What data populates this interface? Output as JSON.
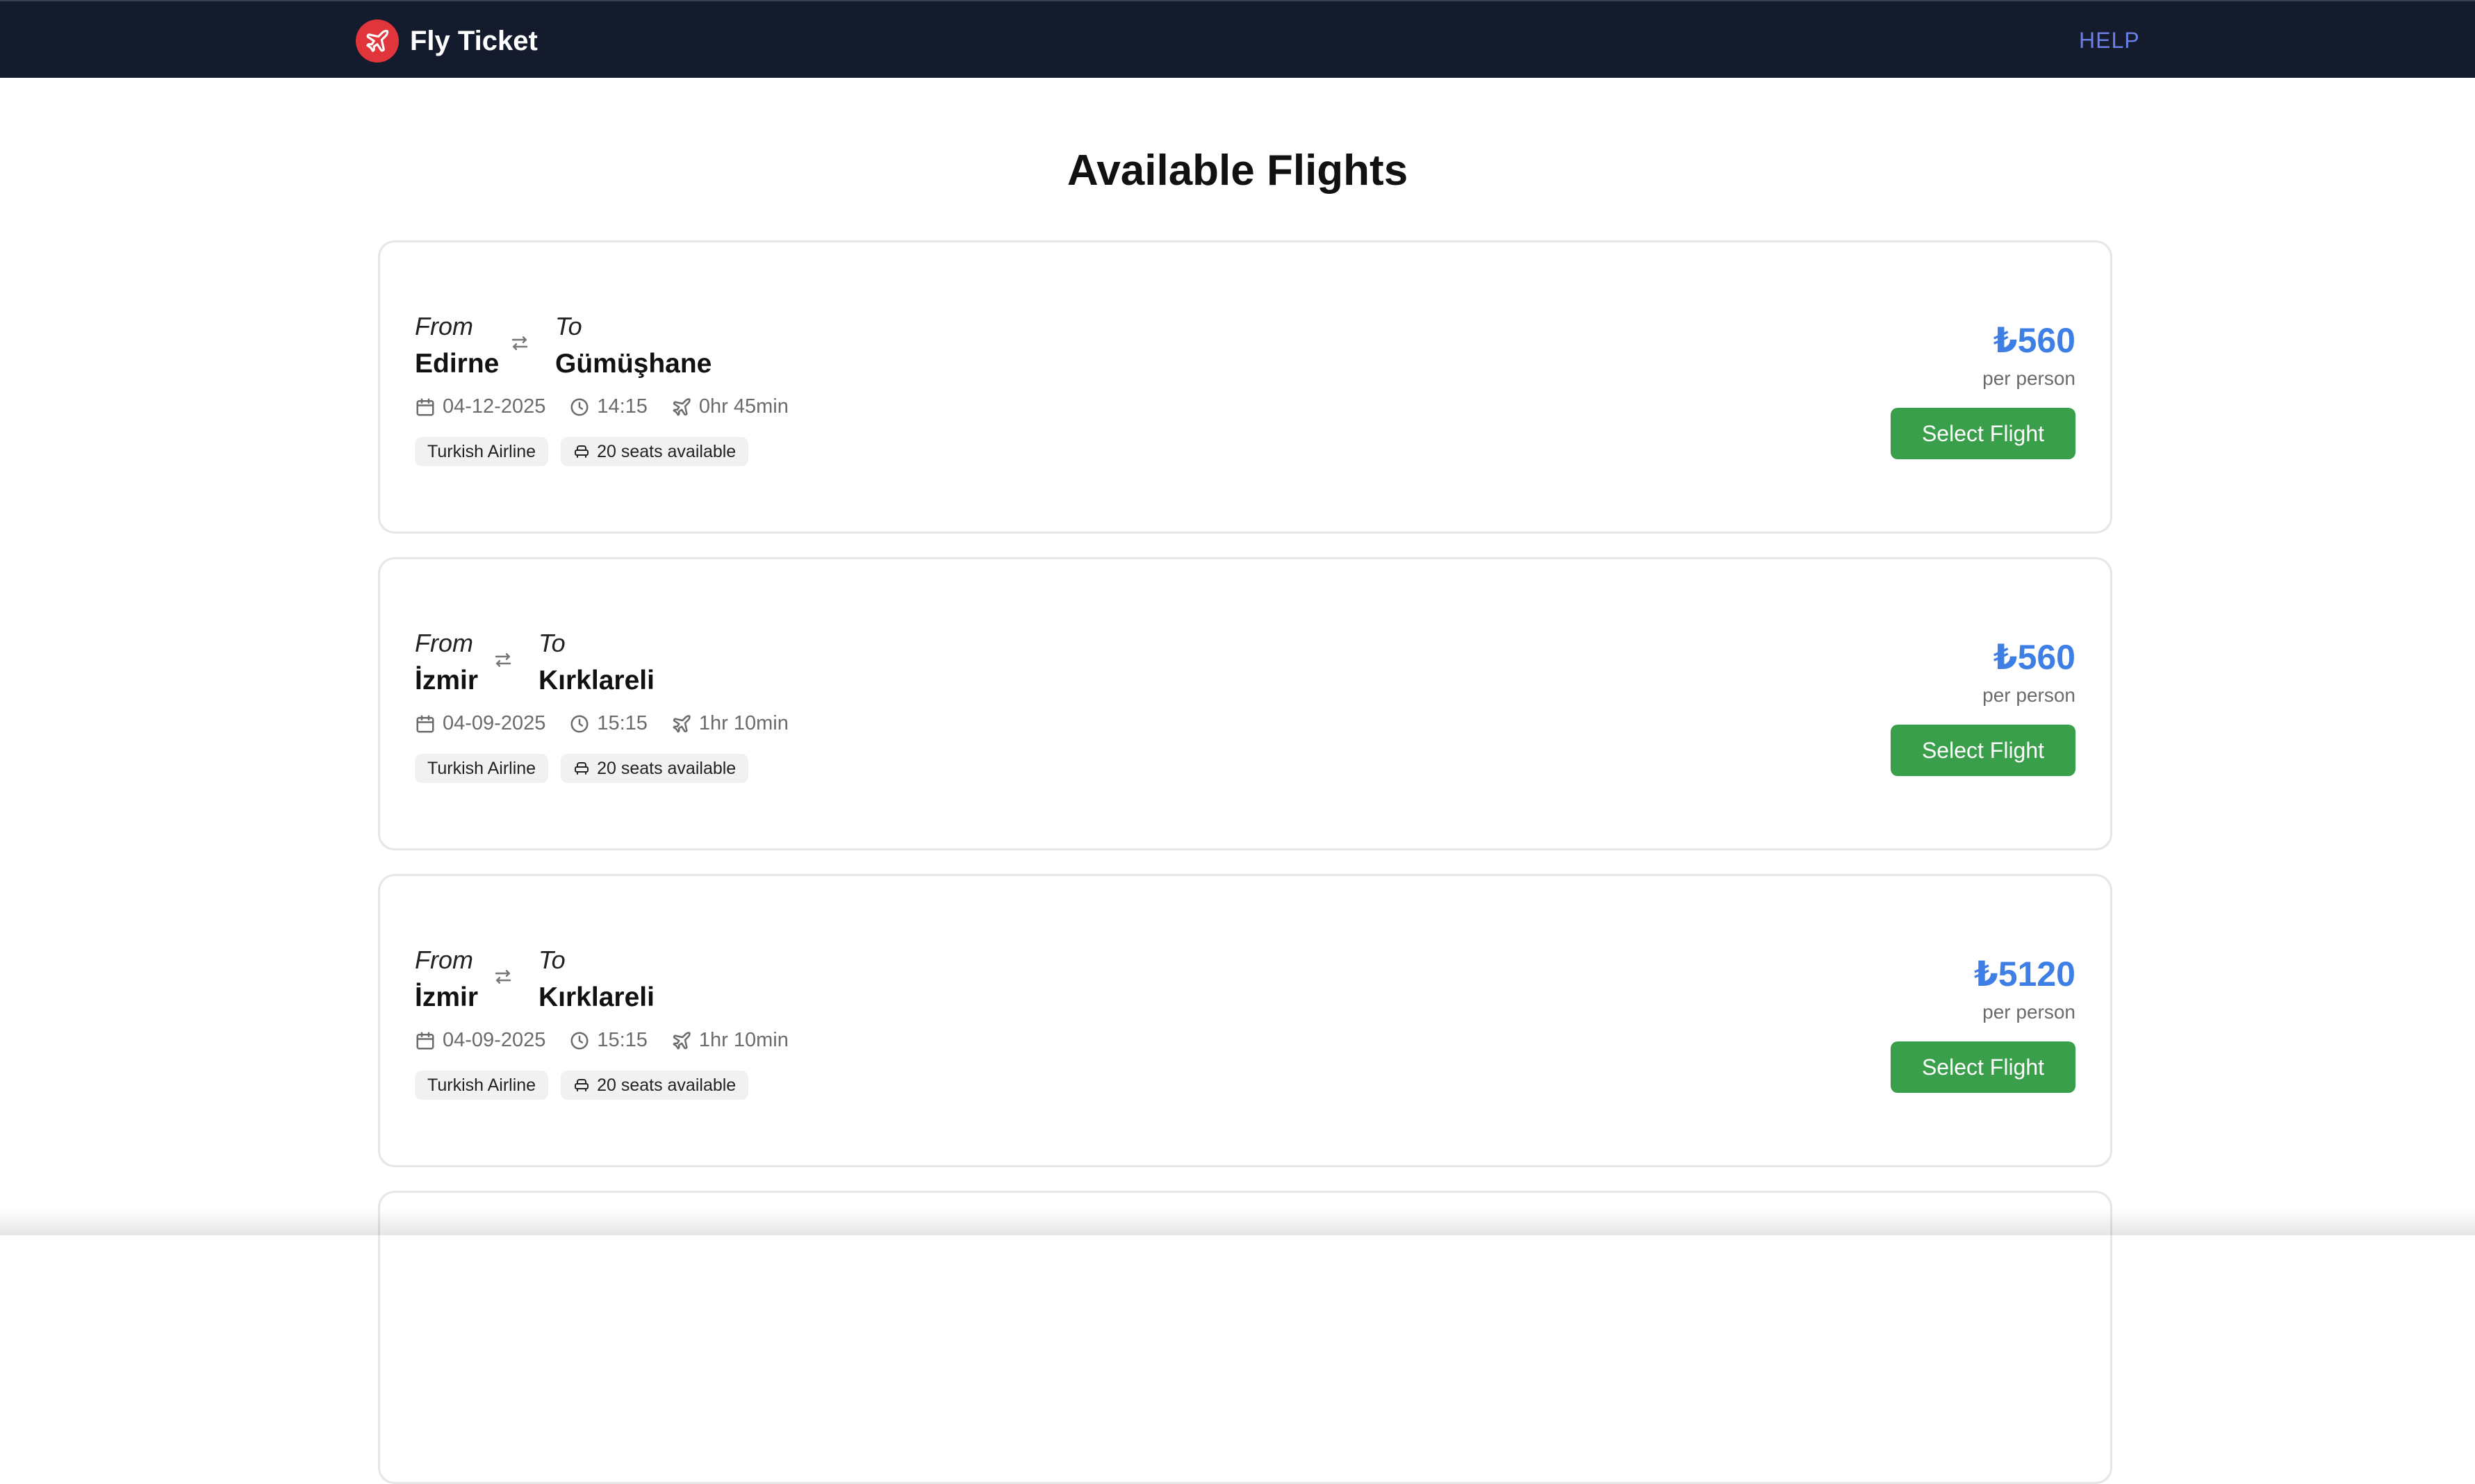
{
  "app": {
    "brand": "Fly Ticket",
    "help_label": "HELP"
  },
  "page": {
    "title": "Available Flights"
  },
  "colors": {
    "navbar": "#141b2d",
    "logo": "#e0353b",
    "price": "#3d7fe4",
    "select_button": "#3a9f4a",
    "help_link": "#6b7fe8"
  },
  "icons": {
    "logo": "plane-icon",
    "swap": "swap-arrows-icon",
    "date": "calendar-icon",
    "time": "clock-icon",
    "duration": "plane-icon",
    "seats": "seat-icon"
  },
  "labels": {
    "from": "From",
    "to": "To",
    "per_person": "per person",
    "select": "Select Flight"
  },
  "flights": [
    {
      "from": "Edirne",
      "to": "Gümüşhane",
      "date": "04-12-2025",
      "time": "14:15",
      "duration": "0hr 45min",
      "airline": "Turkish Airline",
      "seats": "20 seats available",
      "price": "₺560"
    },
    {
      "from": "İzmir",
      "to": "Kırklareli",
      "date": "04-09-2025",
      "time": "15:15",
      "duration": "1hr 10min",
      "airline": "Turkish Airline",
      "seats": "20 seats available",
      "price": "₺560"
    },
    {
      "from": "İzmir",
      "to": "Kırklareli",
      "date": "04-09-2025",
      "time": "15:15",
      "duration": "1hr 10min",
      "airline": "Turkish Airline",
      "seats": "20 seats available",
      "price": "₺5120"
    }
  ]
}
